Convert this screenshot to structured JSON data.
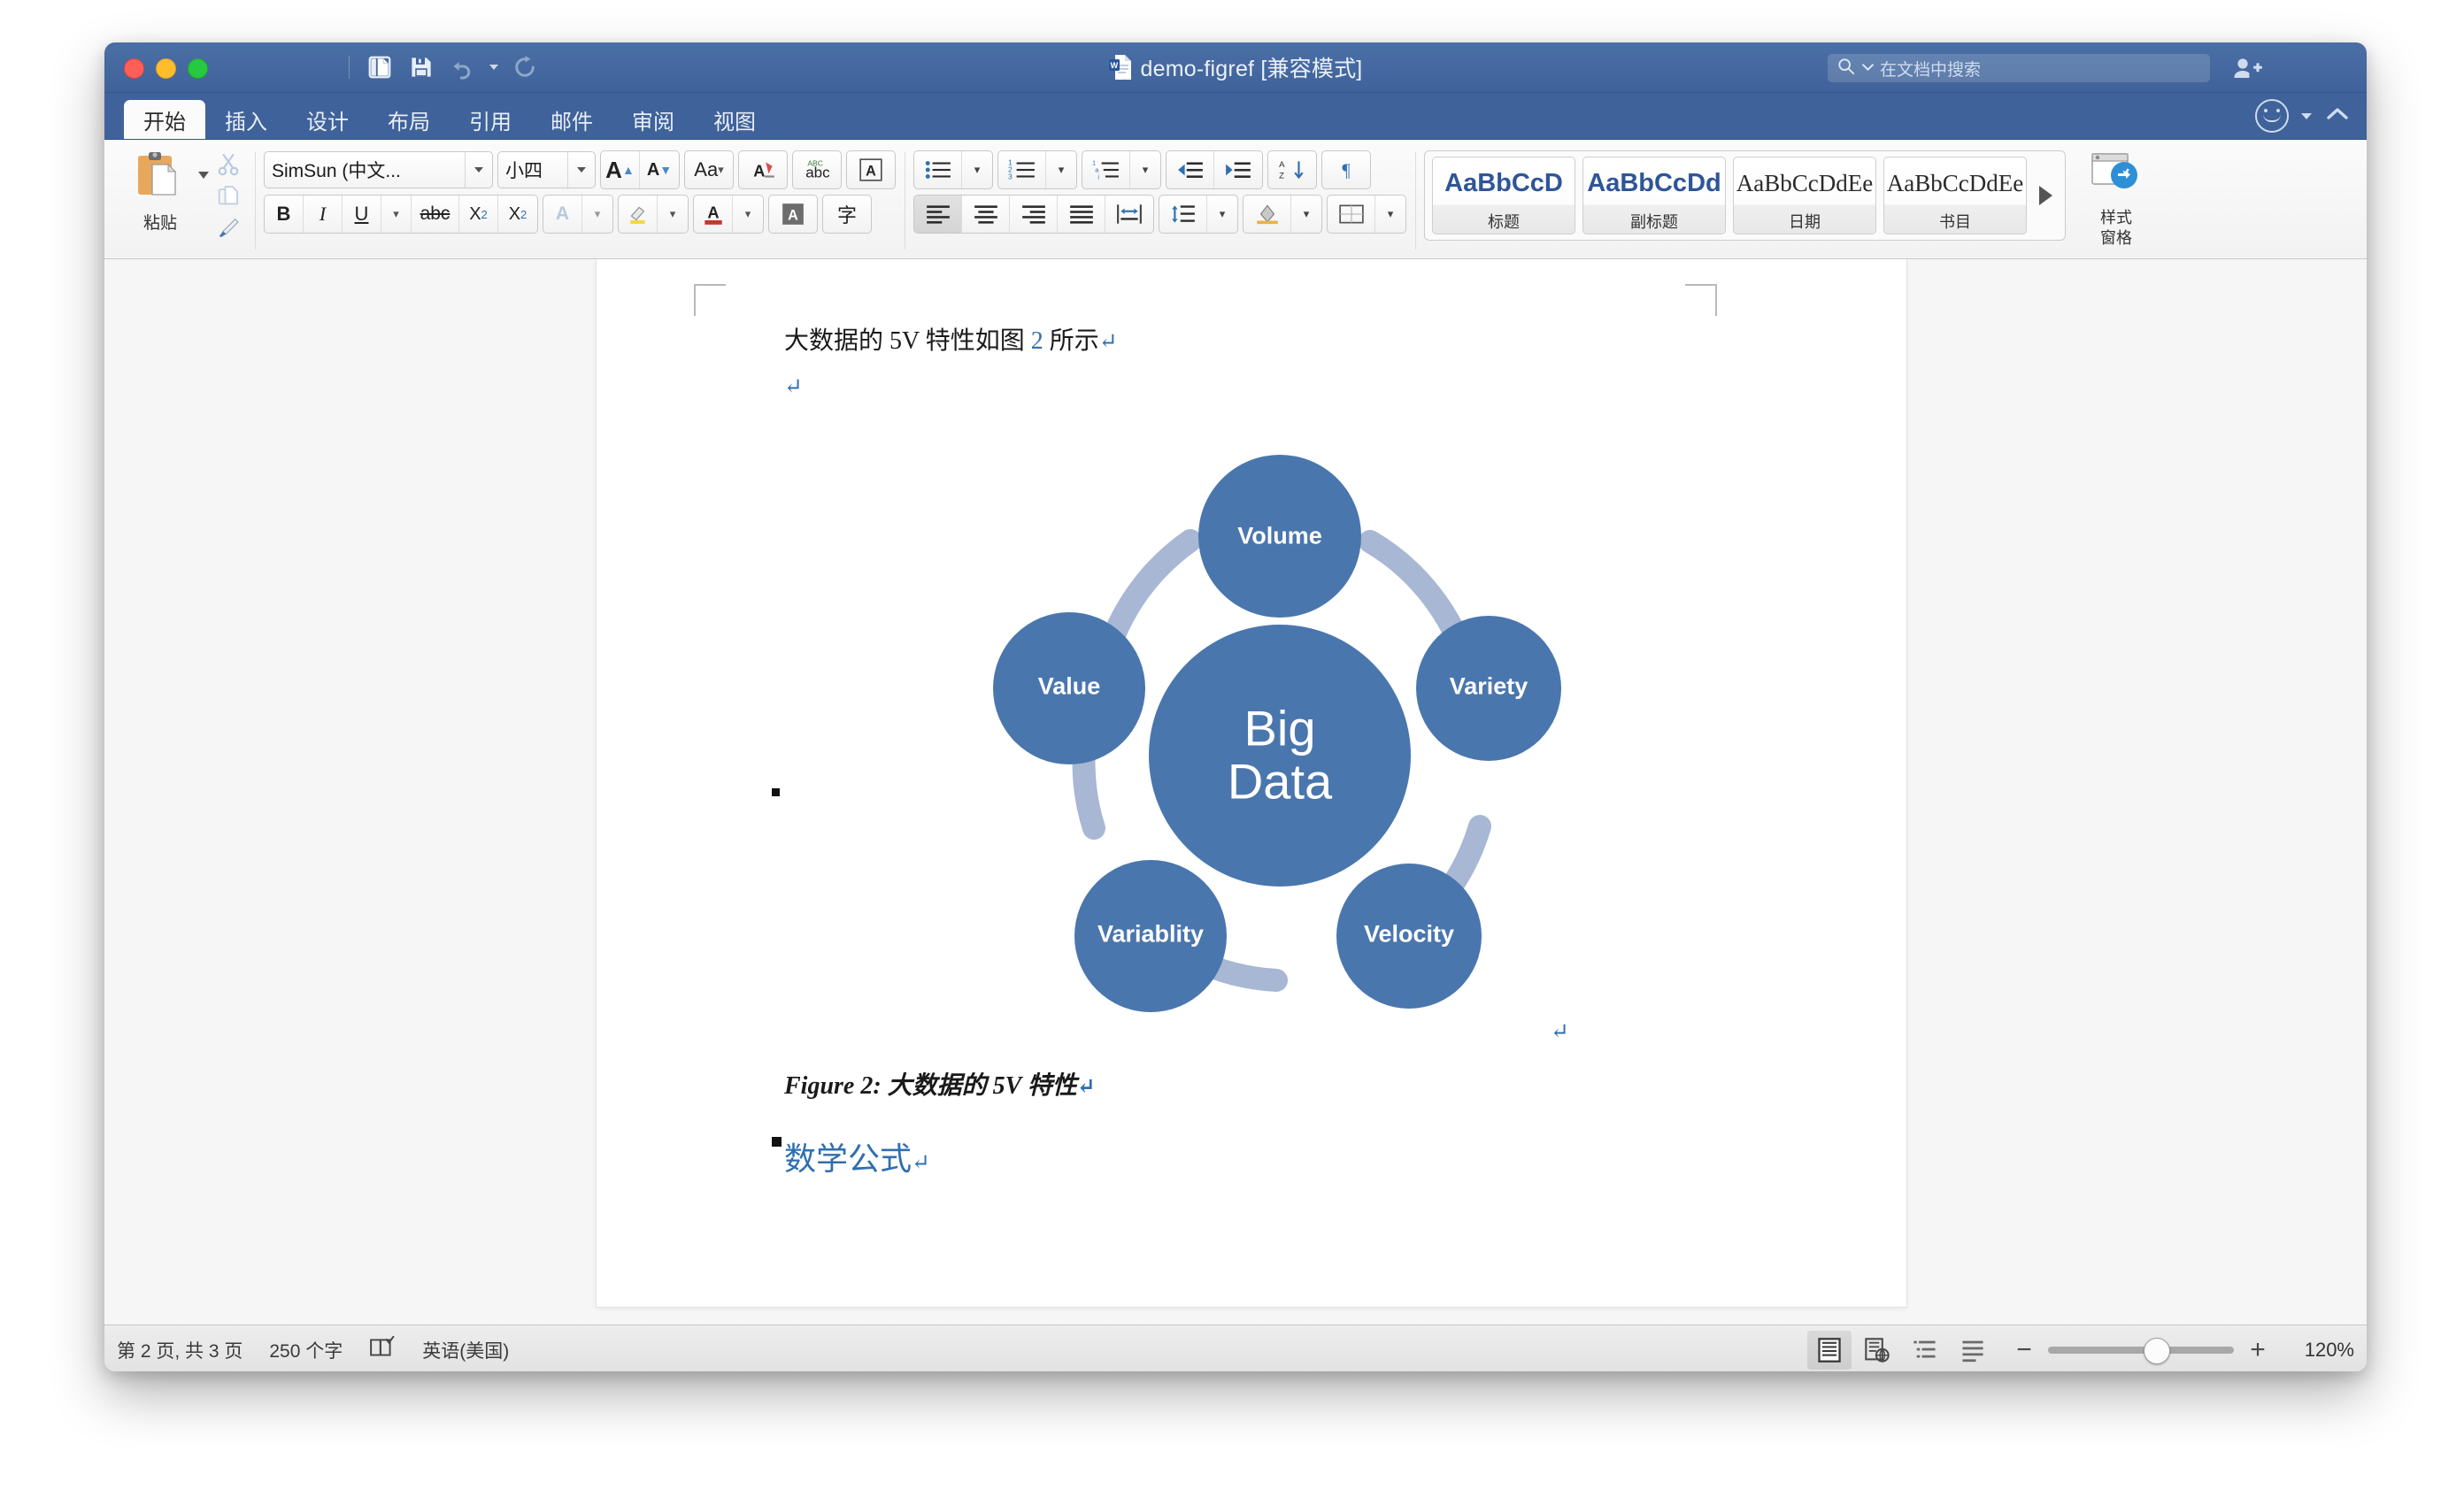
{
  "window": {
    "title": "demo-figref [兼容模式]",
    "doc_icon": "word-document-icon",
    "lights": [
      "close",
      "minimize",
      "zoom"
    ]
  },
  "quick_access": {
    "items": [
      {
        "name": "sidebar-toggle-icon",
        "label": ""
      },
      {
        "name": "save-icon",
        "label": ""
      },
      {
        "name": "undo-icon",
        "label": ""
      },
      {
        "name": "redo-icon",
        "label": ""
      }
    ]
  },
  "search": {
    "placeholder": "在文档中搜索",
    "icon": "search-icon"
  },
  "share": {
    "icon": "add-person-icon"
  },
  "tabs": [
    {
      "label": "开始",
      "active": true
    },
    {
      "label": "插入",
      "active": false
    },
    {
      "label": "设计",
      "active": false
    },
    {
      "label": "布局",
      "active": false
    },
    {
      "label": "引用",
      "active": false
    },
    {
      "label": "邮件",
      "active": false
    },
    {
      "label": "审阅",
      "active": false
    },
    {
      "label": "视图",
      "active": false
    }
  ],
  "ribbon": {
    "paste_label": "粘贴",
    "font": {
      "name": "SimSun (中文...",
      "size": "小四",
      "grow_label": "A",
      "shrink_label": "A",
      "case_label": "Aa",
      "clear_label": "A",
      "bold": "B",
      "italic": "I",
      "underline": "U",
      "strike": "abc",
      "subscript": "X",
      "superscript": "X",
      "text_color": "A",
      "highlight": "A",
      "char_border": "A",
      "phonetic": "字"
    },
    "styles_gallery": [
      {
        "preview": "AaBbCcD",
        "name": "标题",
        "serif": false
      },
      {
        "preview": "AaBbCcDd",
        "name": "副标题",
        "serif": false
      },
      {
        "preview": "AaBbCcDdEe",
        "name": "日期",
        "serif": true
      },
      {
        "preview": "AaBbCcDdEe",
        "name": "书目",
        "serif": true
      }
    ],
    "styles_pane_label": "样式\n窗格",
    "styles_pane_line1": "样式",
    "styles_pane_line2": "窗格"
  },
  "document": {
    "paragraph_1": {
      "before": "大数据的 5V 特性如图 ",
      "xref": "2",
      "after": " 所示",
      "pilcrow": "↵"
    },
    "empty_line_pilcrow": "↵",
    "caption": {
      "text": "Figure 2: 大数据的 5V 特性",
      "pilcrow": "↵"
    },
    "heading": {
      "text": "数学公式",
      "pilcrow": "↵"
    },
    "float_pilcrow": "↵"
  },
  "chart_data": {
    "type": "diagram",
    "title": "大数据的 5V 特性",
    "center_label_line1": "Big",
    "center_label_line2": "Data",
    "nodes": [
      {
        "label": "Volume",
        "angle_deg": 90
      },
      {
        "label": "Variety",
        "angle_deg": 18
      },
      {
        "label": "Velocity",
        "angle_deg": -54
      },
      {
        "label": "Variablity",
        "angle_deg": -126
      },
      {
        "label": "Value",
        "angle_deg": 162
      }
    ],
    "colors": {
      "node_fill": "#4a76ae",
      "ring": "#a7b7d4",
      "text": "#ffffff"
    },
    "legend": "none",
    "grid": false
  },
  "status": {
    "pages": "第 2 页, 共 3 页",
    "words": "250 个字",
    "proofing_icon": "proofing-check-icon",
    "language": "英语(美国)",
    "views": [
      {
        "name": "print-layout-view",
        "active": true
      },
      {
        "name": "web-layout-view",
        "active": false
      },
      {
        "name": "outline-view",
        "active": false
      },
      {
        "name": "draft-view",
        "active": false
      }
    ],
    "zoom_out": "−",
    "zoom_in": "+",
    "zoom_level": "120%"
  }
}
